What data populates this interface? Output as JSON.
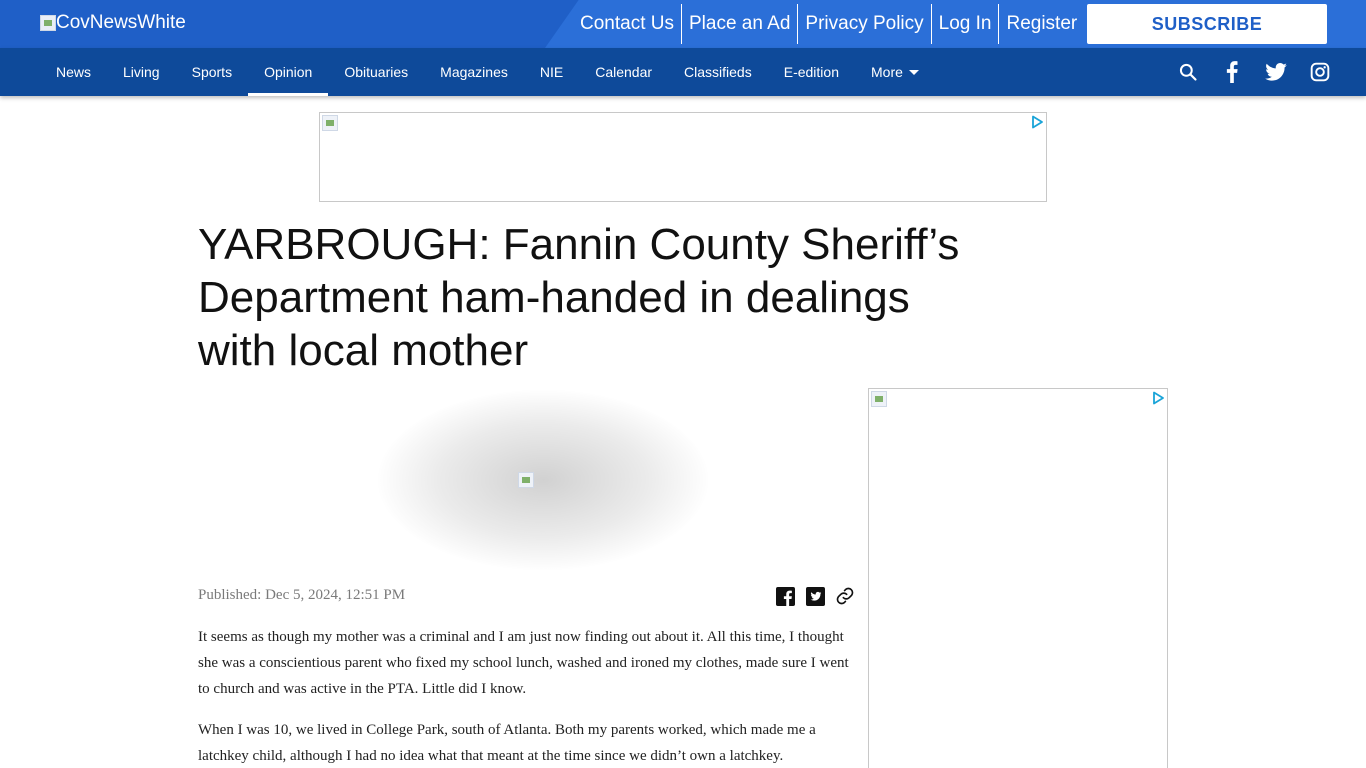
{
  "header": {
    "logo_alt": "CovNewsWhite",
    "top_links": [
      "Contact Us",
      "Place an Ad",
      "Privacy Policy",
      "Log In",
      "Register"
    ],
    "subscribe_label": "SUBSCRIBE"
  },
  "nav": {
    "items": [
      "News",
      "Living",
      "Sports",
      "Opinion",
      "Obituaries",
      "Magazines",
      "NIE",
      "Calendar",
      "Classifieds",
      "E-edition"
    ],
    "more_label": "More",
    "active": "Opinion",
    "icons": [
      "search-icon",
      "facebook-icon",
      "twitter-icon",
      "instagram-icon"
    ]
  },
  "article": {
    "headline": "YARBROUGH: Fannin County Sheriff’s Department ham-handed in dealings with local mother",
    "published": "Published: Dec 5, 2024, 12:51 PM",
    "share_icons": [
      "facebook-share-icon",
      "twitter-share-icon",
      "copy-link-icon"
    ],
    "paragraphs": [
      "It seems as though my mother was a criminal and I am just now finding out about it. All this time, I thought she was a conscientious parent who fixed my school lunch, washed and ironed my clothes, made sure I went to church and was active in the PTA. Little did I know.",
      "When I was 10, we lived in College Park, south of Atlanta. Both my parents worked, which made me a latchkey child, although I had no idea what that meant at the time since we didn’t own a latchkey."
    ]
  },
  "colors": {
    "topbar": "#1f5fc7",
    "navbar": "#0e4a9a",
    "subscribe_text": "#1f5fc7"
  }
}
